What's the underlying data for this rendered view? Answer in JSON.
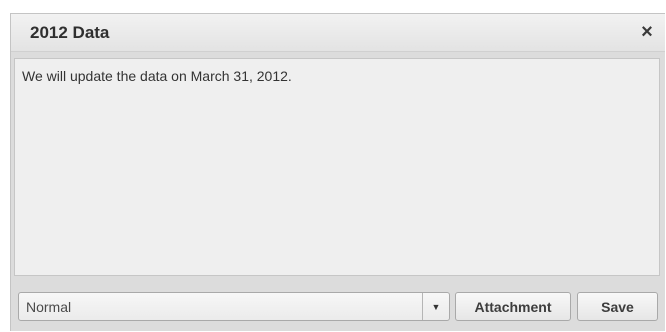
{
  "dialog": {
    "title": "2012 Data",
    "close_glyph": "×",
    "close_icon": "close-icon"
  },
  "message": {
    "value": "We will update the data on March 31, 2012."
  },
  "footer": {
    "format_select": {
      "selected": "Normal",
      "arrow_glyph": "▼",
      "arrow_icon": "chevron-down-icon"
    },
    "attachment_label": "Attachment",
    "save_label": "Save"
  }
}
